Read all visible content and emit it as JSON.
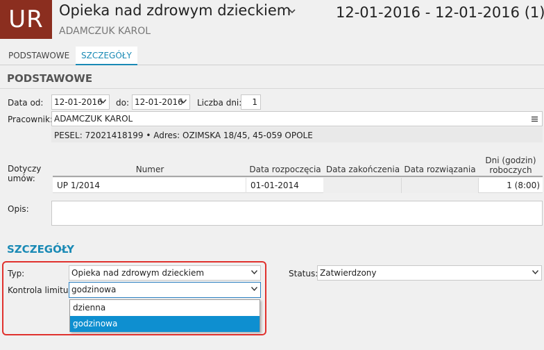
{
  "header": {
    "avatar_text": "UR",
    "title": "Opieka nad zdrowym dzieckiem",
    "subtitle": "ADAMCZUK KAROL",
    "date_range": "12-01-2016 - 12-01-2016 (1)"
  },
  "tabs": [
    {
      "label": "PODSTAWOWE",
      "active": false
    },
    {
      "label": "SZCZEGÓŁY",
      "active": true
    }
  ],
  "basic": {
    "section_title": "PODSTAWOWE",
    "date_from_label": "Data od:",
    "date_from_value": "12-01-2016",
    "date_to_label": "do:",
    "date_to_value": "12-01-2016",
    "days_label": "Liczba dni:",
    "days_value": "1",
    "employee_label": "Pracownik:",
    "employee_value": "ADAMCZUK KAROL",
    "employee_details": "PESEL:  72021418199  •  Adres:  OZIMSKA 18/45, 45-059 OPOLE",
    "contracts_label": "Dotyczy umów:",
    "table": {
      "headers": [
        "Numer",
        "Data rozpoczęcia",
        "Data zakończenia",
        "Data rozwiązania",
        "Dni (godzin) roboczych"
      ],
      "rows": [
        {
          "numer": "UP 1/2014",
          "start": "01-01-2014",
          "end": "",
          "termination": "",
          "days": "1  (8:00)"
        }
      ]
    },
    "description_label": "Opis:",
    "description_value": ""
  },
  "details": {
    "section_title": "SZCZEGÓŁY",
    "type_label": "Typ:",
    "type_value": "Opieka nad zdrowym dzieckiem",
    "status_label": "Status:",
    "status_value": "Zatwierdzony",
    "limit_label": "Kontrola limitu:",
    "limit_value": "godzinowa",
    "limit_options": [
      "dzienna",
      "godzinowa"
    ],
    "limit_selected": "godzinowa"
  },
  "colors": {
    "avatar_bg": "#8b2e1f",
    "accent": "#1a8ab5",
    "highlight_box": "#e0312d",
    "selected_option": "#0e8fd0"
  },
  "icons": {
    "title_dropdown": "chevron-down-icon",
    "select_arrow": "chevron-down-icon",
    "employee_menu": "menu-icon"
  }
}
